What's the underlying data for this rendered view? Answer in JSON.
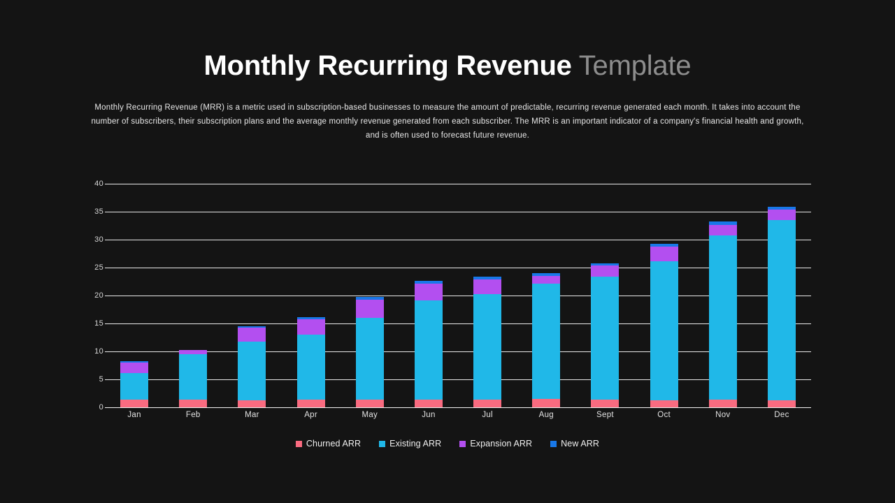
{
  "header": {
    "title_main": "Monthly Recurring Revenue",
    "title_sub": "Template",
    "description": "Monthly Recurring Revenue (MRR) is a metric used in subscription-based businesses to measure the amount of predictable, recurring revenue generated each month. It takes into account the number of subscribers, their subscription plans and the average monthly revenue generated from each subscriber. The MRR is an important indicator of a company's financial health and growth, and is often used to forecast future revenue."
  },
  "colors": {
    "background": "#141414",
    "churned": "#f96b80",
    "existing": "#20b8e8",
    "expansion": "#b34ff0",
    "new": "#1878e8",
    "gridline": "#e9e9e9",
    "title_main": "#ffffff",
    "title_sub": "#8d8d8d"
  },
  "chart_data": {
    "type": "bar",
    "stacked": true,
    "title": "Monthly Recurring Revenue",
    "xlabel": "",
    "ylabel": "",
    "ylim": [
      0,
      40
    ],
    "yticks": [
      0,
      5,
      10,
      15,
      20,
      25,
      30,
      35,
      40
    ],
    "grid": true,
    "legend_position": "bottom",
    "categories": [
      "Jan",
      "Feb",
      "Mar",
      "Apr",
      "May",
      "Jun",
      "Jul",
      "Aug",
      "Sept",
      "Oct",
      "Nov",
      "Dec"
    ],
    "series": [
      {
        "name": "Churned ARR",
        "color": "#f96b80",
        "values": [
          1.4,
          1.4,
          1.3,
          1.4,
          1.4,
          1.4,
          1.4,
          1.5,
          1.4,
          1.3,
          1.4,
          1.3
        ]
      },
      {
        "name": "Existing ARR",
        "color": "#20b8e8",
        "values": [
          4.7,
          8.1,
          10.5,
          11.6,
          14.6,
          17.7,
          18.8,
          20.6,
          22.0,
          24.8,
          29.3,
          32.2
        ]
      },
      {
        "name": "Expansion ARR",
        "color": "#b34ff0",
        "values": [
          1.9,
          0.8,
          2.4,
          2.8,
          3.2,
          3.0,
          2.7,
          1.4,
          2.0,
          2.6,
          1.9,
          1.9
        ]
      },
      {
        "name": "New ARR",
        "color": "#1878e8",
        "values": [
          0.3,
          0.0,
          0.3,
          0.3,
          0.5,
          0.5,
          0.5,
          0.5,
          0.4,
          0.6,
          0.7,
          0.5
        ]
      }
    ],
    "totals": [
      8.3,
      10.3,
      14.5,
      16.1,
      19.7,
      22.6,
      23.4,
      24.0,
      25.8,
      29.3,
      33.3,
      35.9
    ]
  },
  "legend": {
    "items": [
      {
        "label": "Churned ARR",
        "color": "#f96b80"
      },
      {
        "label": "Existing ARR",
        "color": "#20b8e8"
      },
      {
        "label": "Expansion ARR",
        "color": "#b34ff0"
      },
      {
        "label": "New ARR",
        "color": "#1878e8"
      }
    ]
  }
}
